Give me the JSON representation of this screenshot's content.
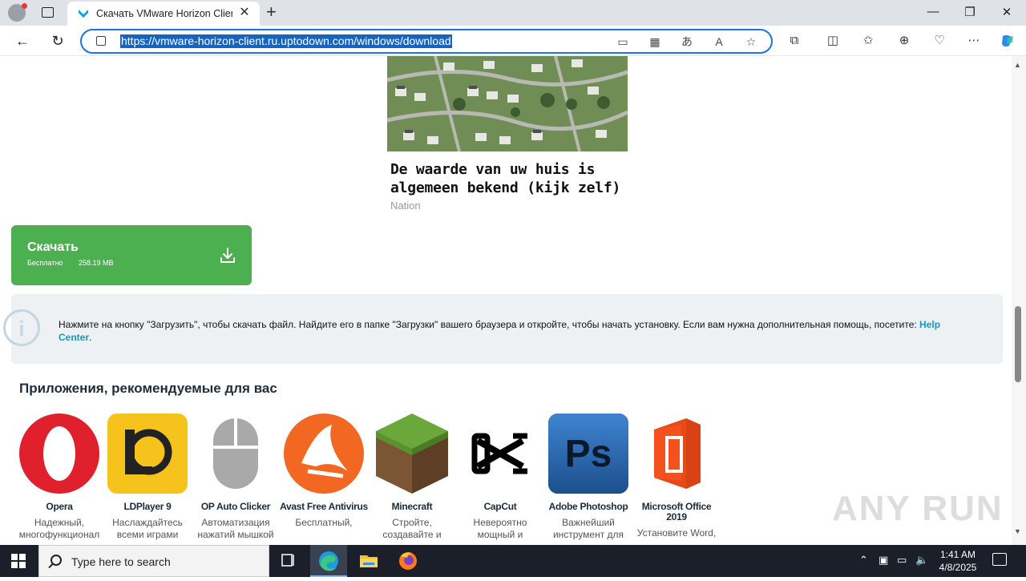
{
  "browser": {
    "tab_title": "Скачать VMware Horizon Client",
    "url": "https://vmware-horizon-client.ru.uptodown.com/windows/download"
  },
  "ad": {
    "title": "De waarde van uw huis is algemeen bekend (kijk zelf)",
    "source": "Nation"
  },
  "download": {
    "label": "Скачать",
    "price": "Бесплатно",
    "size": "258.19 MB",
    "color": "#4caf50"
  },
  "info": {
    "text": "Нажмите на кнопку \"Загрузить\", чтобы скачать файл. Найдите его в папке \"Загрузки\" вашего браузера и откройте, чтобы начать установку. Если вам нужна дополнительная помощь, посетите: ",
    "link": "Help Center",
    "tail": "."
  },
  "recommended": {
    "title": "Приложения, рекомендуемые для вас",
    "apps": [
      {
        "name": "Opera",
        "desc1": "Надежный,",
        "desc2": "многофункционал",
        "icon": "opera-icon"
      },
      {
        "name": "LDPlayer 9",
        "desc1": "Наслаждайтесь",
        "desc2": "всеми играми",
        "icon": "ldplayer-icon"
      },
      {
        "name": "OP Auto Clicker",
        "desc1": "Автоматизация",
        "desc2": "нажатий мышкой",
        "icon": "mouse-icon"
      },
      {
        "name": "Avast Free Antivirus",
        "desc1": "Бесплатный,",
        "desc2": "",
        "icon": "avast-icon"
      },
      {
        "name": "Minecraft",
        "desc1": "Стройте,",
        "desc2": "создавайте и",
        "icon": "minecraft-icon"
      },
      {
        "name": "CapCut",
        "desc1": "Невероятно",
        "desc2": "мощный и",
        "icon": "capcut-icon"
      },
      {
        "name": "Adobe Photoshop",
        "desc1": "Важнейший",
        "desc2": "инструмент для",
        "icon": "photoshop-icon"
      },
      {
        "name": "Microsoft Office 2019",
        "desc1": "Установите Word,",
        "desc2": "",
        "icon": "office-icon"
      }
    ]
  },
  "watermark": "ANY RUN",
  "taskbar": {
    "search_placeholder": "Type here to search",
    "time": "1:41 AM",
    "date": "4/8/2025"
  }
}
